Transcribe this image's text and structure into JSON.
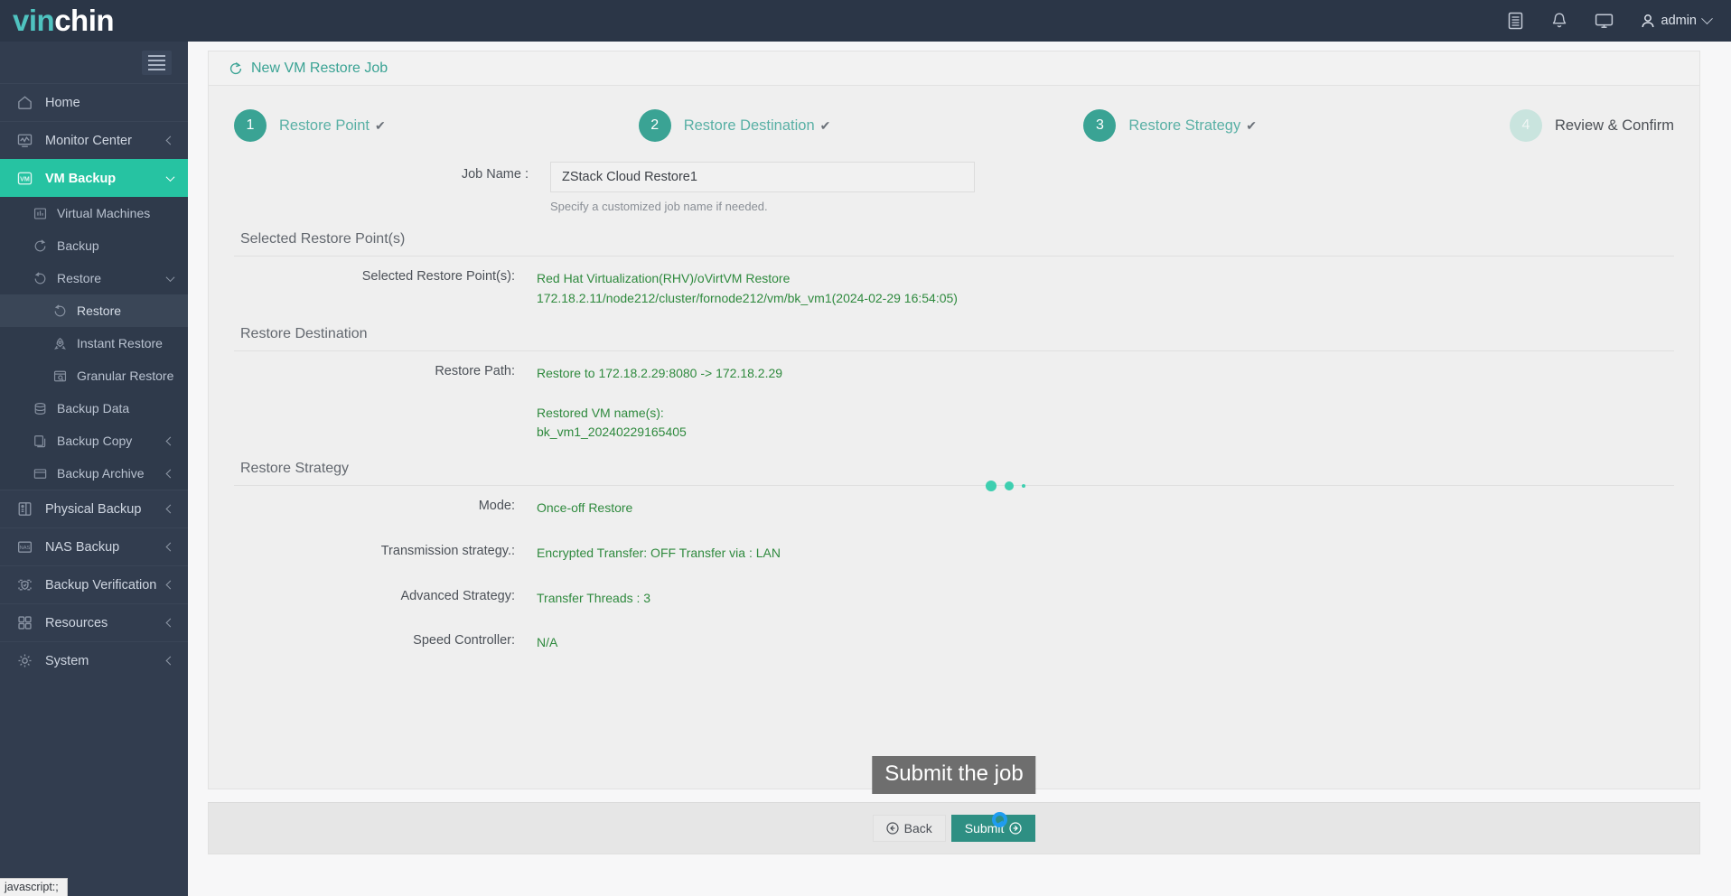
{
  "app": {
    "brand_first": "vin",
    "brand_second": "chin",
    "accent_teal": "#26c3a2",
    "step_teal": "#3aa394",
    "value_green": "#2f8a3e",
    "sidebar_bg": "#323d4f",
    "topbar_bg": "#2b3647"
  },
  "topbar": {
    "icons": [
      "document-icon",
      "bell-icon",
      "monitor-icon"
    ],
    "user": "admin"
  },
  "sidebar": {
    "items": [
      {
        "label": "Home",
        "icon": "home-icon",
        "arrow": "none",
        "state": "normal",
        "level": 1
      },
      {
        "label": "Monitor Center",
        "icon": "monitor-chart-icon",
        "arrow": "left",
        "state": "normal",
        "level": 1
      },
      {
        "label": "VM Backup",
        "icon": "vm-icon",
        "arrow": "down",
        "state": "active",
        "level": 1
      },
      {
        "label": "Virtual Machines",
        "icon": "chart-bars-icon",
        "arrow": "none",
        "state": "normal",
        "level": 2
      },
      {
        "label": "Backup",
        "icon": "refresh-icon",
        "arrow": "none",
        "state": "normal",
        "level": 2
      },
      {
        "label": "Restore",
        "icon": "restore-icon",
        "arrow": "down",
        "state": "normal",
        "level": 2
      },
      {
        "label": "Restore",
        "icon": "restore-icon",
        "arrow": "none",
        "state": "selected",
        "level": 3
      },
      {
        "label": "Instant Restore",
        "icon": "rocket-icon",
        "arrow": "none",
        "state": "normal",
        "level": 3
      },
      {
        "label": "Granular Restore",
        "icon": "granular-icon",
        "arrow": "none",
        "state": "normal",
        "level": 3
      },
      {
        "label": "Backup Data",
        "icon": "database-icon",
        "arrow": "none",
        "state": "normal",
        "level": 2
      },
      {
        "label": "Backup Copy",
        "icon": "copy-icon",
        "arrow": "left",
        "state": "normal",
        "level": 2
      },
      {
        "label": "Backup Archive",
        "icon": "archive-icon",
        "arrow": "left",
        "state": "normal",
        "level": 2
      },
      {
        "label": "Physical Backup",
        "icon": "server-icon",
        "arrow": "left",
        "state": "normal",
        "level": 1
      },
      {
        "label": "NAS Backup",
        "icon": "nas-icon",
        "arrow": "left",
        "state": "normal",
        "level": 1
      },
      {
        "label": "Backup Verification",
        "icon": "shield-check-icon",
        "arrow": "left",
        "state": "normal",
        "level": 1
      },
      {
        "label": "Resources",
        "icon": "grid-icon",
        "arrow": "left",
        "state": "normal",
        "level": 1
      },
      {
        "label": "System",
        "icon": "gear-icon",
        "arrow": "left",
        "state": "normal",
        "level": 1
      }
    ]
  },
  "page": {
    "title": "New VM Restore Job",
    "title_icon": "restore-icon",
    "steps": [
      {
        "num": "1",
        "label": "Restore Point",
        "check": "✔",
        "state": "done"
      },
      {
        "num": "2",
        "label": "Restore Destination",
        "check": "✔",
        "state": "done"
      },
      {
        "num": "3",
        "label": "Restore Strategy",
        "check": "✔",
        "state": "done"
      },
      {
        "num": "4",
        "label": "Review & Confirm",
        "check": "",
        "state": "pending"
      }
    ],
    "job_name": {
      "label": "Job Name :",
      "value": "ZStack Cloud Restore1",
      "placeholder": "",
      "hint": "Specify a customized job name if needed."
    },
    "sections": [
      {
        "title": "Selected Restore Point(s)",
        "rows": [
          {
            "label": "Selected Restore Point(s):",
            "lines": [
              "Red Hat Virtualization(RHV)/oVirtVM Restore",
              "172.18.2.11/node212/cluster/fornode212/vm/bk_vm1(2024-02-29 16:54:05)"
            ]
          }
        ]
      },
      {
        "title": "Restore Destination",
        "rows": [
          {
            "label": "Restore Path:",
            "lines": [
              "Restore to 172.18.2.29:8080 -> 172.18.2.29",
              "",
              "Restored VM name(s):",
              "bk_vm1_20240229165405"
            ]
          }
        ]
      },
      {
        "title": "Restore Strategy",
        "rows": [
          {
            "label": "Mode:",
            "lines": [
              "Once-off Restore"
            ]
          },
          {
            "label": "Transmission strategy.:",
            "lines": [
              "Encrypted Transfer: OFF Transfer via : LAN"
            ]
          },
          {
            "label": "Advanced Strategy:",
            "lines": [
              "Transfer Threads : 3"
            ]
          },
          {
            "label": "Speed Controller:",
            "lines": [
              "N/A"
            ]
          }
        ]
      }
    ],
    "loading_dots": 3
  },
  "footer": {
    "back_label": "Back",
    "submit_label": "Submit",
    "tooltip": "Submit the job"
  },
  "browser": {
    "status_text": "javascript:;"
  }
}
